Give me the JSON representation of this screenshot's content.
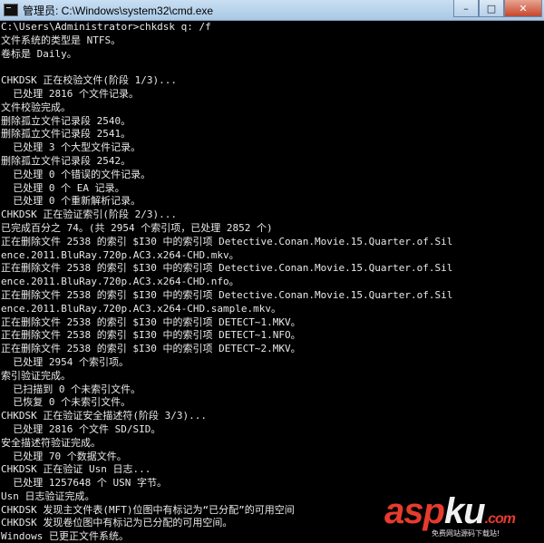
{
  "window": {
    "title": "管理员: C:\\Windows\\system32\\cmd.exe",
    "controls": {
      "minimize": "–",
      "maximize": "□",
      "close": "✕"
    }
  },
  "console": {
    "lines": [
      "C:\\Users\\Administrator>chkdsk q: /f",
      "文件系统的类型是 NTFS。",
      "卷标是 Daily。",
      "",
      "CHKDSK 正在校验文件(阶段 1/3)...",
      "  已处理 2816 个文件记录。",
      "文件校验完成。",
      "删除孤立文件记录段 2540。",
      "删除孤立文件记录段 2541。",
      "  已处理 3 个大型文件记录。",
      "删除孤立文件记录段 2542。",
      "  已处理 0 个错误的文件记录。",
      "  已处理 0 个 EA 记录。",
      "  已处理 0 个重新解析记录。",
      "CHKDSK 正在验证索引(阶段 2/3)...",
      "已完成百分之 74。(共 2954 个索引项，已处理 2852 个)",
      "正在删除文件 2538 的索引 $I30 中的索引项 Detective.Conan.Movie.15.Quarter.of.Sil",
      "ence.2011.BluRay.720p.AC3.x264-CHD.mkv。",
      "正在删除文件 2538 的索引 $I30 中的索引项 Detective.Conan.Movie.15.Quarter.of.Sil",
      "ence.2011.BluRay.720p.AC3.x264-CHD.nfo。",
      "正在删除文件 2538 的索引 $I30 中的索引项 Detective.Conan.Movie.15.Quarter.of.Sil",
      "ence.2011.BluRay.720p.AC3.x264-CHD.sample.mkv。",
      "正在删除文件 2538 的索引 $I30 中的索引项 DETECT~1.MKV。",
      "正在删除文件 2538 的索引 $I30 中的索引项 DETECT~1.NFO。",
      "正在删除文件 2538 的索引 $I30 中的索引项 DETECT~2.MKV。",
      "  已处理 2954 个索引项。",
      "索引验证完成。",
      "  已扫描到 0 个未索引文件。",
      "  已恢复 0 个未索引文件。",
      "CHKDSK 正在验证安全描述符(阶段 3/3)...",
      "  已处理 2816 个文件 SD/SID。",
      "安全描述符验证完成。",
      "  已处理 70 个数据文件。",
      "CHKDSK 正在验证 Usn 日志...",
      "  已处理 1257648 个 USN 字节。",
      "Usn 日志验证完成。",
      "CHKDSK 发现主文件表(MFT)位图中有标记为“已分配”的可用空间",
      "CHKDSK 发现卷位图中有标记为已分配的可用空间。",
      "Windows 已更正文件系统。"
    ]
  },
  "watermark": {
    "logo_part1": "asp",
    "logo_part2": "ku",
    "logo_suffix": ".com",
    "subtitle": "免费网站源码下载站!",
    "accent_color": "#e63b2e"
  }
}
